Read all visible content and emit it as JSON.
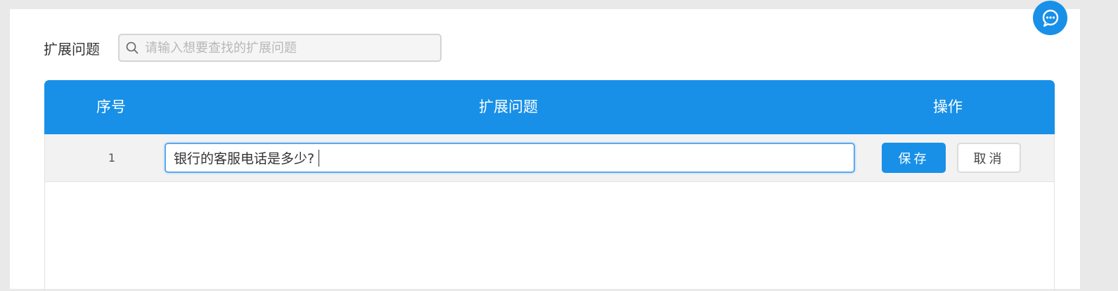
{
  "search": {
    "label": "扩展问题",
    "placeholder": "请输入想要查找的扩展问题",
    "value": ""
  },
  "table": {
    "headers": {
      "index": "序号",
      "question": "扩展问题",
      "actions": "操作"
    },
    "rows": [
      {
        "index": "1",
        "question": "银行的客服电话是多少?",
        "save_label": "保存",
        "cancel_label": "取消"
      }
    ]
  },
  "icons": {
    "search": "search-icon",
    "chat": "chat-bubble-icon"
  },
  "colors": {
    "primary": "#1890e8",
    "background": "#e9e9e9",
    "row_background": "#f2f2f2"
  }
}
